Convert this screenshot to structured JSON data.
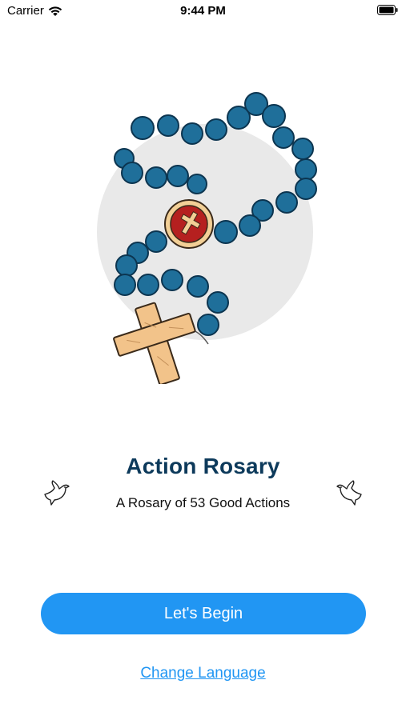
{
  "status_bar": {
    "carrier": "Carrier",
    "time": "9:44 PM"
  },
  "app": {
    "title": "Action Rosary",
    "subtitle": "A Rosary of 53 Good Actions",
    "primary_button": "Let's Begin",
    "language_link": "Change Language"
  },
  "icons": [
    "wifi-icon",
    "battery-icon",
    "rosary-illustration",
    "dove-icon"
  ],
  "colors": {
    "accent": "#2196f3",
    "title": "#0d3a5b",
    "bead": "#1f6f9a"
  }
}
